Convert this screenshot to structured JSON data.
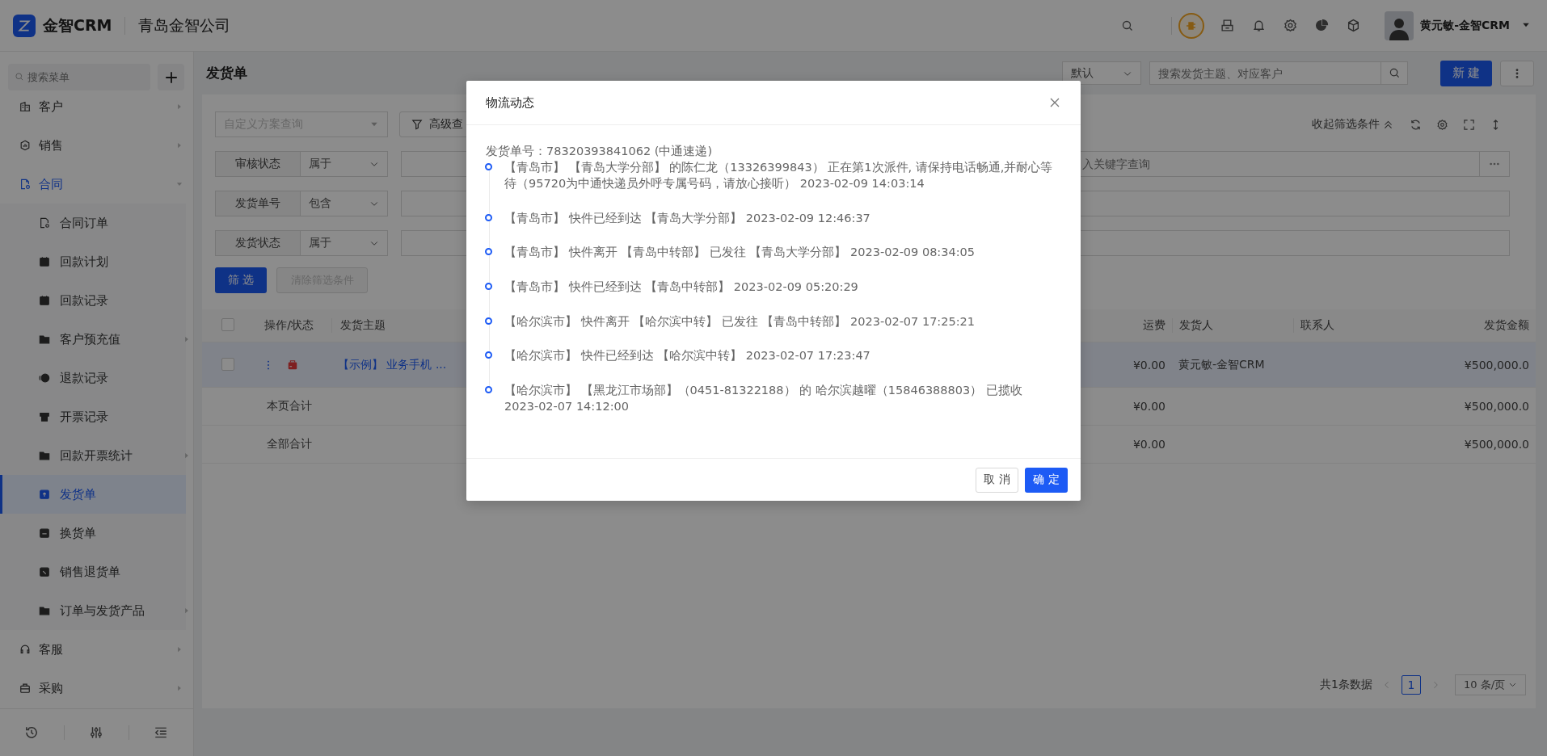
{
  "topbar": {
    "brand": "金智CRM",
    "company": "青岛金智公司",
    "user": "黄元敏-金智CRM"
  },
  "sidebar": {
    "search_placeholder": "搜索菜单",
    "menu": [
      {
        "label": "客户",
        "selected": false,
        "expanded": false
      },
      {
        "label": "销售",
        "selected": false,
        "expanded": false
      },
      {
        "label": "合同",
        "selected": false,
        "expanded": true,
        "children": [
          {
            "label": "合同订单",
            "selected": false
          },
          {
            "label": "回款计划",
            "selected": false
          },
          {
            "label": "回款记录",
            "selected": false
          },
          {
            "label": "客户预充值",
            "selected": false,
            "expanded": false
          },
          {
            "label": "退款记录",
            "selected": false
          },
          {
            "label": "开票记录",
            "selected": false
          },
          {
            "label": "回款开票统计",
            "selected": false,
            "expanded": false
          },
          {
            "label": "发货单",
            "selected": true
          },
          {
            "label": "换货单",
            "selected": false
          },
          {
            "label": "销售退货单",
            "selected": false
          },
          {
            "label": "订单与发货产品",
            "selected": false,
            "expanded": false
          }
        ]
      },
      {
        "label": "客服",
        "selected": false,
        "expanded": false
      },
      {
        "label": "采购",
        "selected": false,
        "expanded": false
      }
    ]
  },
  "page_header": {
    "title": "发货单",
    "view_select": "默认",
    "search_placeholder": "搜索发货主题、对应客户",
    "new_button": "新 建"
  },
  "filters": {
    "custom_query_placeholder": "自定义方案查询",
    "advanced_button": "高级查",
    "collapse_label": "收起筛选条件",
    "rows": [
      {
        "label": "审核状态",
        "operator": "属于",
        "placeholder": "入关键字查询"
      },
      {
        "label": "发货单号",
        "operator": "包含"
      },
      {
        "label": "发货状态",
        "operator": "属于"
      }
    ],
    "apply_button": "筛 选",
    "clear_button": "清除筛选条件"
  },
  "table": {
    "select_all_checked": false,
    "columns": [
      "操作/状态",
      "发货主题",
      "运费",
      "发货人",
      "联系人",
      "发货金额"
    ],
    "rows": [
      {
        "kind": "record",
        "selected": true,
        "checked": false,
        "subject": "【示例】 业务手机 ...",
        "freight": "¥0.00",
        "shipper": "黄元敏-金智CRM",
        "amount": "¥500,000.0"
      },
      {
        "kind": "summary",
        "label": "本页合计",
        "freight": "¥0.00",
        "amount": "¥500,000.0"
      },
      {
        "kind": "summary",
        "label": "全部合计",
        "freight": "¥0.00",
        "amount": "¥500,000.0"
      }
    ]
  },
  "pagination": {
    "total": "共1条数据",
    "pages": [
      {
        "label": "1",
        "selected": true
      }
    ],
    "page_size": "10 条/页"
  },
  "modal": {
    "title": "物流动态",
    "tracking": "发货单号：78320393841062 (中通速递)",
    "events": [
      "【青岛市】 【青岛大学分部】 的陈仁龙（13326399843） 正在第1次派件, 请保持电话畅通,并耐心等待（95720为中通快递员外呼专属号码，请放心接听） 2023-02-09 14:03:14",
      "【青岛市】 快件已经到达 【青岛大学分部】 2023-02-09 12:46:37",
      "【青岛市】 快件离开 【青岛中转部】 已发往 【青岛大学分部】 2023-02-09 08:34:05",
      "【青岛市】 快件已经到达 【青岛中转部】 2023-02-09 05:20:29",
      "【哈尔滨市】 快件离开 【哈尔滨中转】 已发往 【青岛中转部】 2023-02-07 17:25:21",
      "【哈尔滨市】 快件已经到达 【哈尔滨中转】 2023-02-07 17:23:47",
      "【哈尔滨市】 【黑龙江市场部】（0451-81322188） 的 哈尔滨越曜（15846388803） 已揽收 2023-02-07 14:12:00"
    ],
    "cancel_button": "取 消",
    "ok_button": "确 定"
  }
}
